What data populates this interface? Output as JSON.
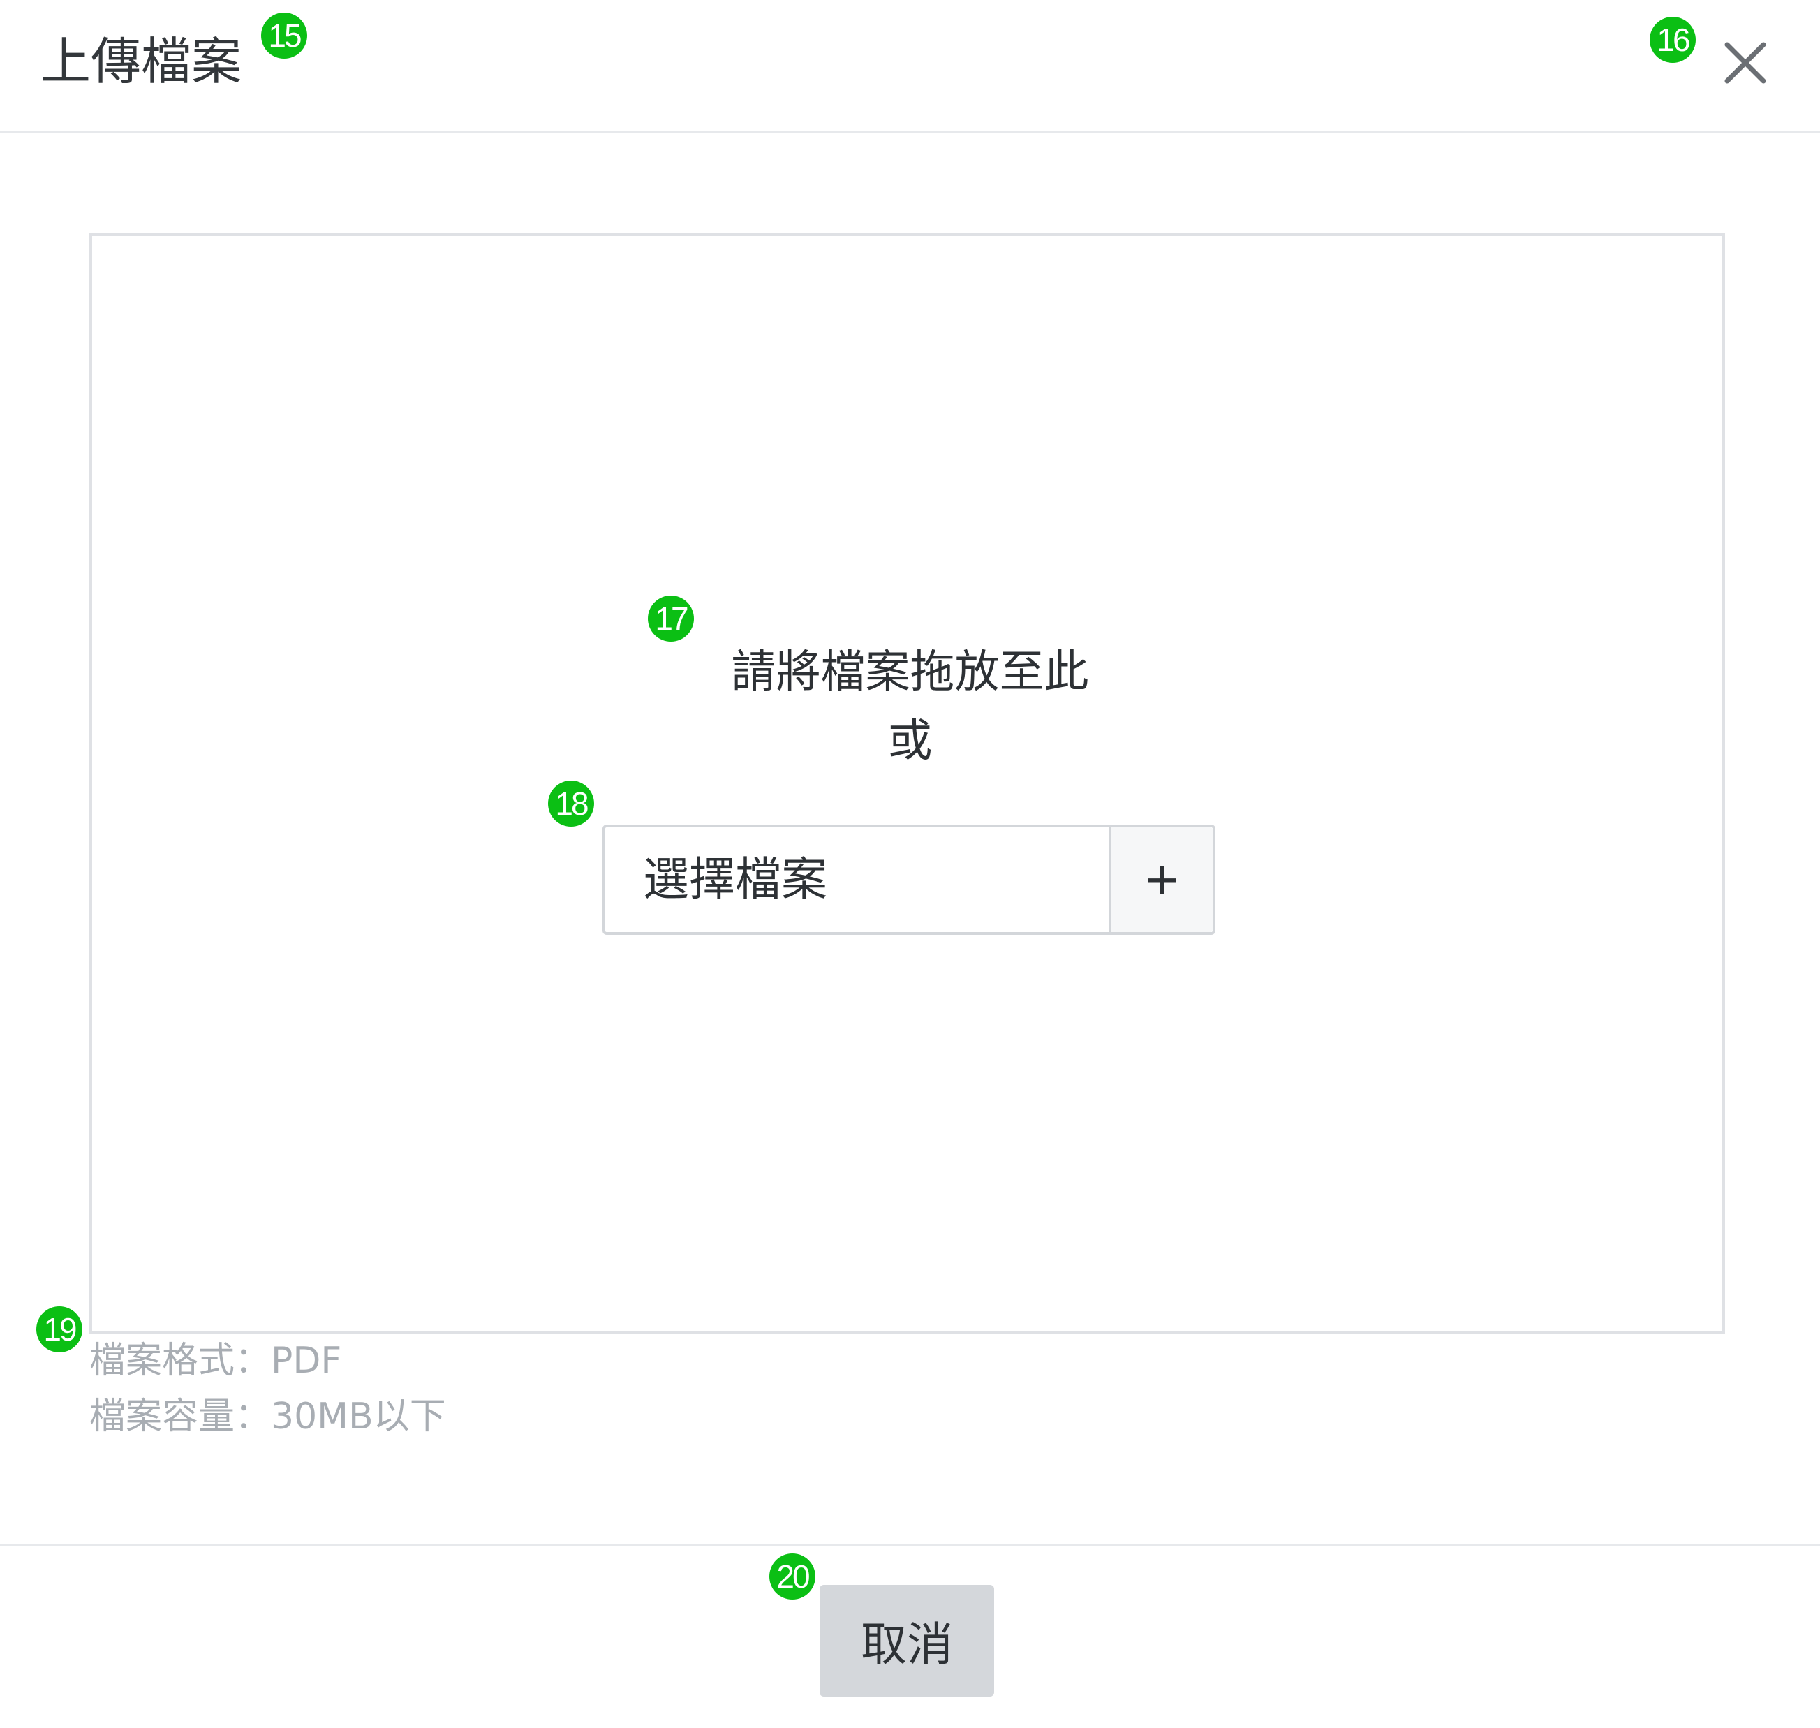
{
  "dialog": {
    "title": "上傳檔案",
    "close_icon": "close-icon"
  },
  "dropzone": {
    "drop_text": "請將檔案拖放至此",
    "or_text": "或",
    "file_button_label": "選擇檔案",
    "file_button_icon": "+"
  },
  "notes": {
    "format": "檔案格式：PDF",
    "size": "檔案容量：30MB以下"
  },
  "footer": {
    "cancel_label": "取消"
  },
  "annotations": {
    "b15": "15",
    "b16": "16",
    "b17": "17",
    "b18": "18",
    "b19": "19",
    "b20": "20"
  },
  "colors": {
    "badge": "#0bbf14",
    "cancel_bg": "#d4d7db",
    "border": "#dfe1e5",
    "note_text": "#a8adb3"
  }
}
